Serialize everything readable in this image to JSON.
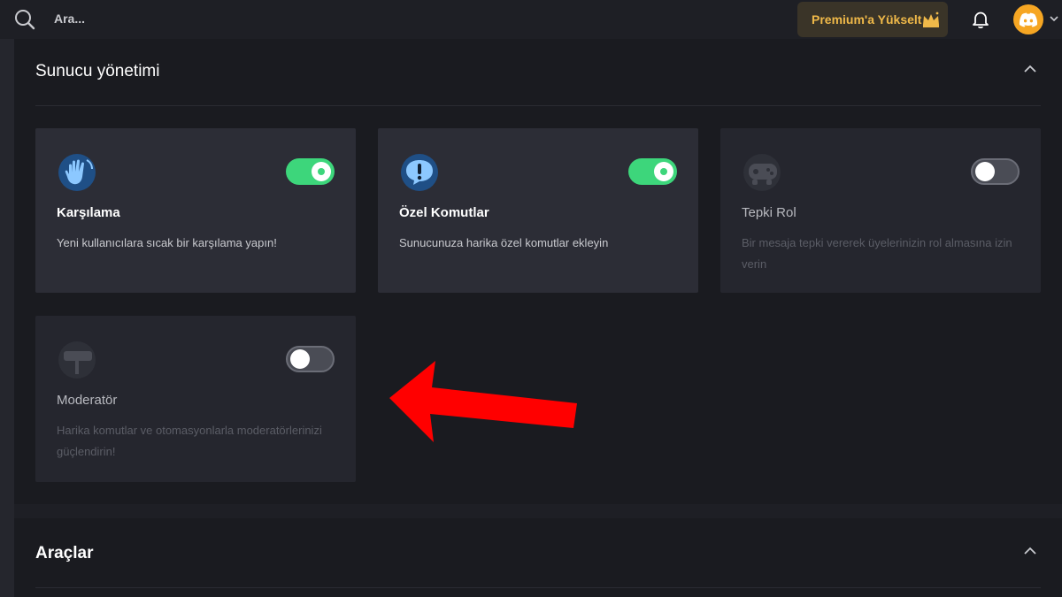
{
  "topbar": {
    "search_placeholder": "Ara...",
    "premium_label": "Premium'a Yükselt",
    "icons": [
      "search-icon",
      "crown-icon",
      "bell-icon",
      "discord-icon",
      "chevron-down-icon"
    ]
  },
  "section_server": {
    "title": "Sunucu yönetimi",
    "cards": [
      {
        "title": "Karşılama",
        "description": "Yeni kullanıcılara sıcak bir karşılama yapın!",
        "enabled": true,
        "icon": "wave-hand-icon"
      },
      {
        "title": "Özel Komutlar",
        "description": "Sunucunuza harika özel komutlar ekleyin",
        "enabled": true,
        "icon": "exclamation-bubble-icon"
      },
      {
        "title": "Tepki Rol",
        "description": "Bir mesaja tepki vererek üyelerinizin rol almasına izin verin",
        "enabled": false,
        "icon": "gamepad-icon"
      },
      {
        "title": "Moderatör",
        "description": "Harika komutlar ve otomasyonlarla moderatörlerinizi güçlendirin!",
        "enabled": false,
        "icon": "gavel-icon"
      }
    ]
  },
  "section_tools": {
    "title": "Araçlar"
  },
  "colors": {
    "accent_green": "#3dd67b",
    "premium_gold": "#f0b949",
    "arrow_red": "#ff0000",
    "avatar_orange": "#f6a623"
  }
}
